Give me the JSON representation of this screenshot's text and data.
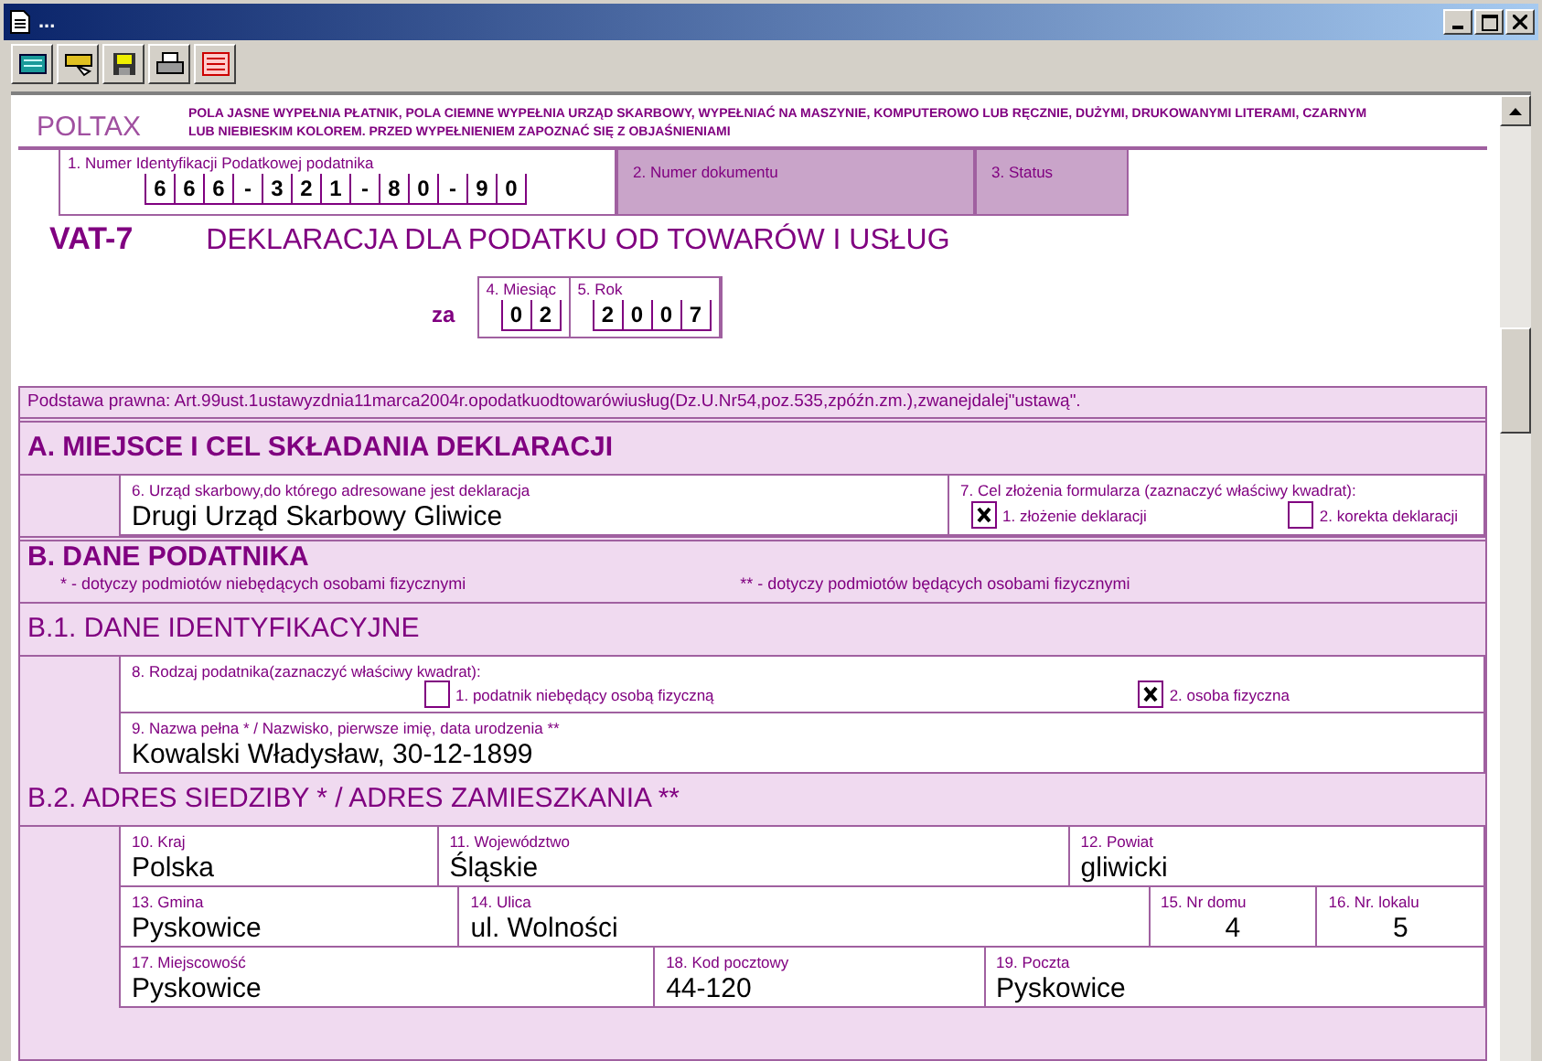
{
  "window": {
    "title": "..."
  },
  "form": {
    "logo": "POLTAX",
    "instructions": "POLA JASNE WYPEŁNIA PŁATNIK, POLA CIEMNE WYPEŁNIA URZĄD SKARBOWY, WYPEŁNIAĆ NA MASZYNIE, KOMPUTEROWO LUB RĘCZNIE, DUŻYMI, DRUKOWANYMI LITERAMI, CZARNYM LUB NIEBIESKIM KOLOREM. PRZED WYPEŁNIENIEM ZAPOZNAĆ SIĘ Z OBJAŚNIENIAMI",
    "nip": {
      "label": "1. Numer Identyfikacji Podatkowej podatnika",
      "chars": [
        "6",
        "6",
        "6",
        "-",
        "3",
        "2",
        "1",
        "-",
        "8",
        "0",
        "-",
        "9",
        "0"
      ]
    },
    "document_number": {
      "label": "2. Numer dokumentu"
    },
    "status": {
      "label": "3. Status"
    },
    "form_code": "VAT-7",
    "title": "DEKLARACJA DLA PODATKU OD TOWARÓW I USŁUG",
    "period": {
      "prefix": "za",
      "month": {
        "label": "4. Miesiąc",
        "chars": [
          "0",
          "2"
        ]
      },
      "year": {
        "label": "5. Rok",
        "chars": [
          "2",
          "0",
          "0",
          "7"
        ]
      }
    },
    "legal_basis": "Podstawa prawna: Art.99ust.1ustawyzdnia11marca2004r.opodatkuodtowarówiusług(Dz.U.Nr54,poz.535,zpóźn.zm.),zwanejdalej\"ustawą\".",
    "section_a": {
      "title": "A. MIEJSCE I CEL SKŁADANIA DEKLARACJI",
      "office": {
        "label": "6. Urząd skarbowy,do którego adresowane jest deklaracja",
        "value": "Drugi Urząd Skarbowy Gliwice"
      },
      "purpose": {
        "label": "7. Cel złożenia formularza  (zaznaczyć właściwy kwadrat):",
        "options": [
          {
            "label": "1. złożenie deklaracji",
            "checked": true
          },
          {
            "label": "2. korekta deklaracji",
            "checked": false
          }
        ]
      }
    },
    "section_b": {
      "title": "B. DANE PODATNIKA",
      "note_1": "* - dotyczy podmiotów niebędących osobami fizycznymi",
      "note_2": "** - dotyczy podmiotów będących osobami fizycznymi",
      "b1": {
        "title": "B.1. DANE IDENTYFIKACYJNE",
        "taxpayer_type": {
          "label": "8. Rodzaj podatnika(zaznaczyć właściwy kwadrat):",
          "options": [
            {
              "label": "1. podatnik niebędący osobą fizyczną",
              "checked": false
            },
            {
              "label": "2. osoba fizyczna",
              "checked": true
            }
          ]
        },
        "name": {
          "label": "9. Nazwa pełna * / Nazwisko, pierwsze imię, data urodzenia **",
          "value": "Kowalski Władysław, 30-12-1899"
        }
      },
      "b2": {
        "title": "B.2. ADRES SIEDZIBY * / ADRES ZAMIESZKANIA **",
        "rows": [
          [
            {
              "label": "10. Kraj",
              "value": "Polska"
            },
            {
              "label": "11. Województwo",
              "value": "Śląskie"
            },
            {
              "label": "12. Powiat",
              "value": "gliwicki"
            }
          ],
          [
            {
              "label": "13. Gmina",
              "value": "Pyskowice"
            },
            {
              "label": "14. Ulica",
              "value": "ul. Wolności"
            },
            {
              "label": "15. Nr domu",
              "value": "4"
            },
            {
              "label": "16. Nr. lokalu",
              "value": "5"
            }
          ],
          [
            {
              "label": "17. Miejscowość",
              "value": "Pyskowice"
            },
            {
              "label": "18. Kod pocztowy",
              "value": "44-120"
            },
            {
              "label": "19. Poczta",
              "value": "Pyskowice"
            }
          ]
        ]
      }
    }
  }
}
